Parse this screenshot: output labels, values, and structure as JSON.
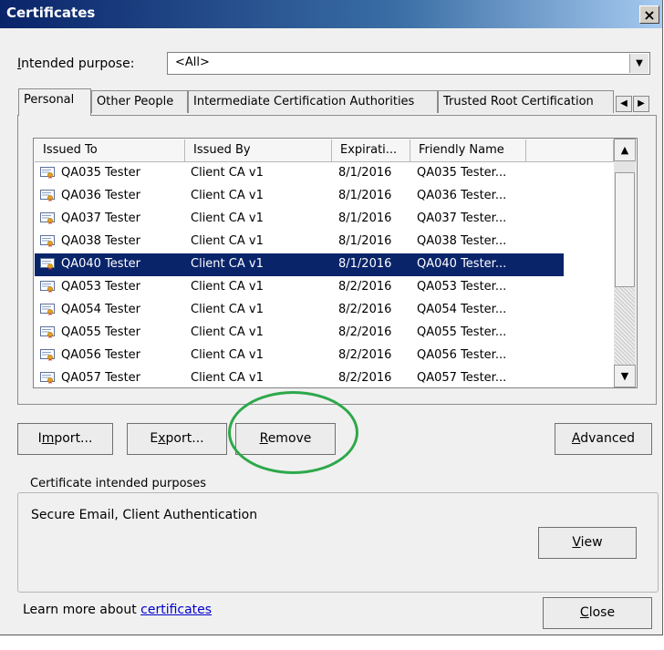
{
  "window": {
    "title": "Certificates",
    "close_glyph": "×"
  },
  "purpose": {
    "label_pre": "I",
    "label_rest": "ntended purpose:",
    "value": "<All>"
  },
  "tabs": [
    {
      "label": "Personal",
      "active": true
    },
    {
      "label": "Other People",
      "active": false
    },
    {
      "label": "Intermediate Certification Authorities",
      "active": false
    },
    {
      "label": "Trusted Root Certification",
      "active": false
    }
  ],
  "table": {
    "columns": [
      "Issued To",
      "Issued By",
      "Expirati...",
      "Friendly Name"
    ],
    "rows": [
      {
        "issued_to": "QA035 Tester",
        "issued_by": "Client CA v1",
        "expiration": "8/1/2016",
        "friendly": "QA035 Tester...",
        "selected": false
      },
      {
        "issued_to": "QA036 Tester",
        "issued_by": "Client CA v1",
        "expiration": "8/1/2016",
        "friendly": "QA036 Tester...",
        "selected": false
      },
      {
        "issued_to": "QA037 Tester",
        "issued_by": "Client CA v1",
        "expiration": "8/1/2016",
        "friendly": "QA037 Tester...",
        "selected": false
      },
      {
        "issued_to": "QA038 Tester",
        "issued_by": "Client CA v1",
        "expiration": "8/1/2016",
        "friendly": "QA038 Tester...",
        "selected": false
      },
      {
        "issued_to": "QA040 Tester",
        "issued_by": "Client CA v1",
        "expiration": "8/1/2016",
        "friendly": "QA040 Tester...",
        "selected": true
      },
      {
        "issued_to": "QA053 Tester",
        "issued_by": "Client CA v1",
        "expiration": "8/2/2016",
        "friendly": "QA053 Tester...",
        "selected": false
      },
      {
        "issued_to": "QA054 Tester",
        "issued_by": "Client CA v1",
        "expiration": "8/2/2016",
        "friendly": "QA054 Tester...",
        "selected": false
      },
      {
        "issued_to": "QA055 Tester",
        "issued_by": "Client CA v1",
        "expiration": "8/2/2016",
        "friendly": "QA055 Tester...",
        "selected": false
      },
      {
        "issued_to": "QA056 Tester",
        "issued_by": "Client CA v1",
        "expiration": "8/2/2016",
        "friendly": "QA056 Tester...",
        "selected": false
      },
      {
        "issued_to": "QA057 Tester",
        "issued_by": "Client CA v1",
        "expiration": "8/2/2016",
        "friendly": "QA057 Tester...",
        "selected": false
      }
    ]
  },
  "buttons": {
    "import": {
      "pre": "I",
      "key": "m",
      "post": "port..."
    },
    "export": {
      "pre": "E",
      "key": "x",
      "post": "port..."
    },
    "remove": {
      "pre": "",
      "key": "R",
      "post": "emove"
    },
    "advanced": {
      "pre": "",
      "key": "A",
      "post": "dvanced"
    },
    "view": {
      "pre": "",
      "key": "V",
      "post": "iew"
    },
    "close": {
      "pre": "",
      "key": "C",
      "post": "lose"
    }
  },
  "intended_purposes": {
    "legend": "Certificate intended purposes",
    "value": "Secure Email, Client Authentication"
  },
  "learn_more": {
    "prefix": "Learn more about ",
    "link": "certificates"
  },
  "icons": {
    "certificate": "certificate-icon",
    "combo_drop": "▼",
    "tab_left": "◀",
    "tab_right": "▶",
    "scroll_up": "▲",
    "scroll_down": "▼"
  },
  "colors": {
    "title_start": "#0a246a",
    "title_end": "#a6caf0",
    "selection": "#0a246a",
    "link": "#0000cc",
    "highlight_circle": "#2da84a"
  }
}
